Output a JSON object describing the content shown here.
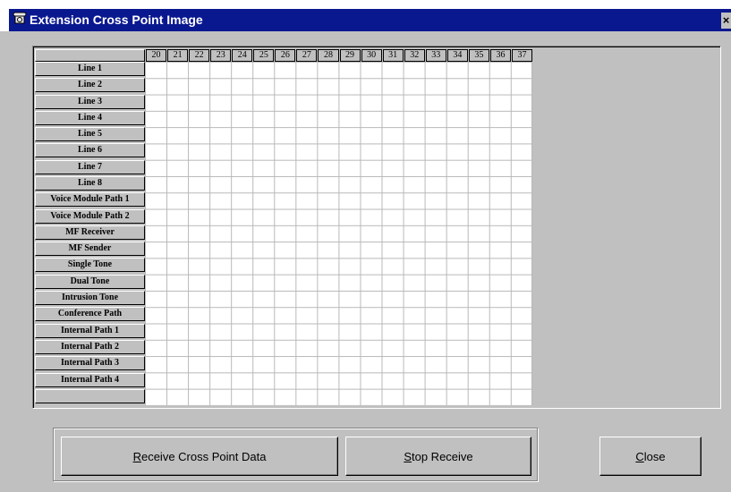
{
  "window": {
    "title": "Extension Cross Point Image",
    "close_glyph": "×"
  },
  "grid": {
    "columns": [
      "20",
      "21",
      "22",
      "23",
      "24",
      "25",
      "26",
      "27",
      "28",
      "29",
      "30",
      "31",
      "32",
      "33",
      "34",
      "35",
      "36",
      "37"
    ],
    "rows": [
      "Line 1",
      "Line 2",
      "Line 3",
      "Line 4",
      "Line 5",
      "Line 6",
      "Line 7",
      "Line 8",
      "Voice Module Path 1",
      "Voice Module Path 2",
      "MF Receiver",
      "MF Sender",
      "Single Tone",
      "Dual Tone",
      "Intrusion Tone",
      "Conference Path",
      "Internal Path 1",
      "Internal Path 2",
      "Internal Path 3",
      "Internal Path 4",
      ""
    ]
  },
  "buttons": {
    "receive": {
      "accel": "R",
      "rest": "eceive Cross Point Data"
    },
    "stop": {
      "accel": "S",
      "rest": "top Receive"
    },
    "close": {
      "accel": "C",
      "rest": "lose"
    }
  }
}
